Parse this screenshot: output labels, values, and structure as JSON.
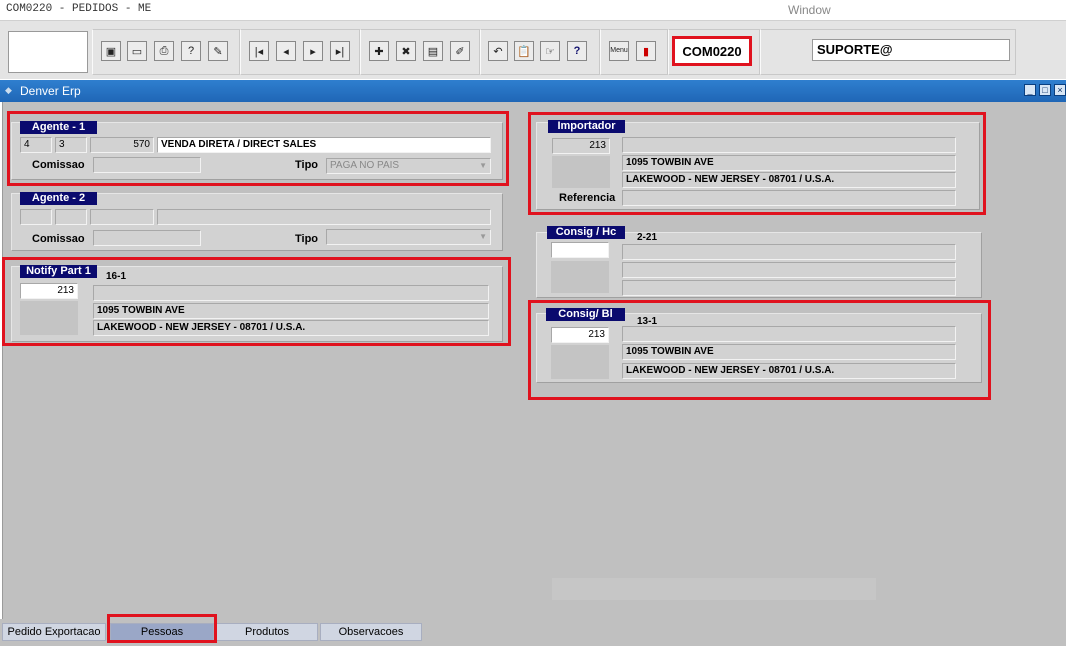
{
  "window": {
    "title": "COM0220 - PEDIDOS - ME",
    "menu_window": "Window"
  },
  "toolbar": {
    "form_code": "COM0220",
    "user": "SUPORTE@",
    "menu_icon_label": "Menu"
  },
  "mdi": {
    "title": "Denver Erp"
  },
  "agente1": {
    "title": "Agente - 1",
    "f1": "4",
    "f2": "3",
    "code": "570",
    "name": "VENDA DIRETA / DIRECT SALES",
    "comissao_label": "Comissao",
    "comissao_value": "",
    "tipo_label": "Tipo",
    "tipo_value": "PAGA NO PAIS"
  },
  "agente2": {
    "title": "Agente - 2",
    "comissao_label": "Comissao",
    "tipo_label": "Tipo"
  },
  "notify": {
    "title": "Notify Part 1",
    "ref": "16-1",
    "code": "213",
    "line1": "",
    "line2": "1095 TOWBIN AVE",
    "line3": "LAKEWOOD - NEW JERSEY - 08701 / U.S.A."
  },
  "importador": {
    "title": "Importador",
    "code": "213",
    "line1": "",
    "line2": "1095 TOWBIN AVE",
    "line3": "LAKEWOOD - NEW JERSEY - 08701 / U.S.A.",
    "referencia_label": "Referencia",
    "referencia_value": ""
  },
  "consig_hc": {
    "title": "Consig / Hc",
    "ref": "2-21"
  },
  "consig_bl": {
    "title": "Consig/ Bl",
    "ref": "13-1",
    "code": "213",
    "line1": "",
    "line2": "1095 TOWBIN AVE",
    "line3": "LAKEWOOD - NEW JERSEY - 08701 / U.S.A."
  },
  "tabs": [
    {
      "label": "Pedido Exportacao"
    },
    {
      "label": "Pessoas"
    },
    {
      "label": "Produtos"
    },
    {
      "label": "Observacoes"
    }
  ],
  "colors": {
    "highlight": "#e0121e",
    "panel_title_bg": "#0a0a6e",
    "window_title_bg": "#1f66b6"
  }
}
